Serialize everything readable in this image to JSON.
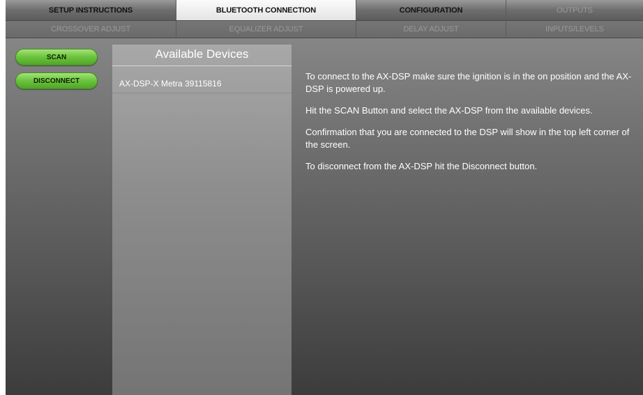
{
  "tabs_row1": [
    {
      "label": "SETUP INSTRUCTIONS",
      "state": "normal"
    },
    {
      "label": "BLUETOOTH CONNECTION",
      "state": "active"
    },
    {
      "label": "CONFIGURATION",
      "state": "normal"
    },
    {
      "label": "OUTPUTS",
      "state": "disabled"
    }
  ],
  "tabs_row2": [
    {
      "label": "CROSSOVER ADJUST"
    },
    {
      "label": "EQUALIZER ADJUST"
    },
    {
      "label": "DELAY ADJUST"
    },
    {
      "label": "INPUTS/LEVELS"
    }
  ],
  "buttons": {
    "scan_label": "SCAN",
    "disconnect_label": "DISCONNECT",
    "accent_color": "#6bc33c"
  },
  "devices": {
    "title": "Available Devices",
    "items": [
      {
        "name": "AX-DSP-X Metra 39115816"
      }
    ]
  },
  "instructions": [
    "To connect to the AX-DSP make sure the ignition is in the on position and the AX-DSP is powered up.",
    "Hit the SCAN Button and select the AX-DSP from the available devices.",
    "Confirmation that you are connected to the DSP will show in the top left corner of the screen.",
    "To disconnect from the AX-DSP hit the Disconnect button."
  ]
}
